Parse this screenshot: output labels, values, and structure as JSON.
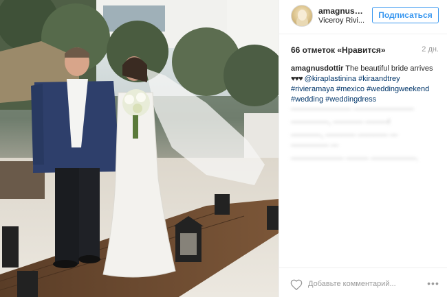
{
  "post": {
    "username": "amagnusdo...",
    "location": "Viceroy Rivi...",
    "follow_label": "Подписаться",
    "likes_text": "66 отметок «Нравится»",
    "time_ago": "2 дн.",
    "caption_user": "amagnusdottir",
    "caption_text": "The beautiful bride arrives",
    "caption_hearts": "♥♥♥",
    "caption_tags": [
      "@kiraplastinina",
      "#kiraandtrey",
      "#rivieramaya",
      "#mexico",
      "#weddingweekend",
      "#wedding",
      "#weddingdress"
    ],
    "comment_placeholder": "Добавьте комментарий...",
    "more_label": "•••"
  },
  "blurred_comments": [
    "———————— ————————",
    "—————, ———— ———!",
    "————, ———— ———— — ————— —",
    "——————— ——— ——————."
  ],
  "icons": {
    "heart": "heart-icon",
    "more": "more-options-icon",
    "avatar": "avatar"
  },
  "colors": {
    "accent": "#3897f0",
    "hashtag": "#003569",
    "muted": "#999999",
    "divider": "#efefef"
  }
}
